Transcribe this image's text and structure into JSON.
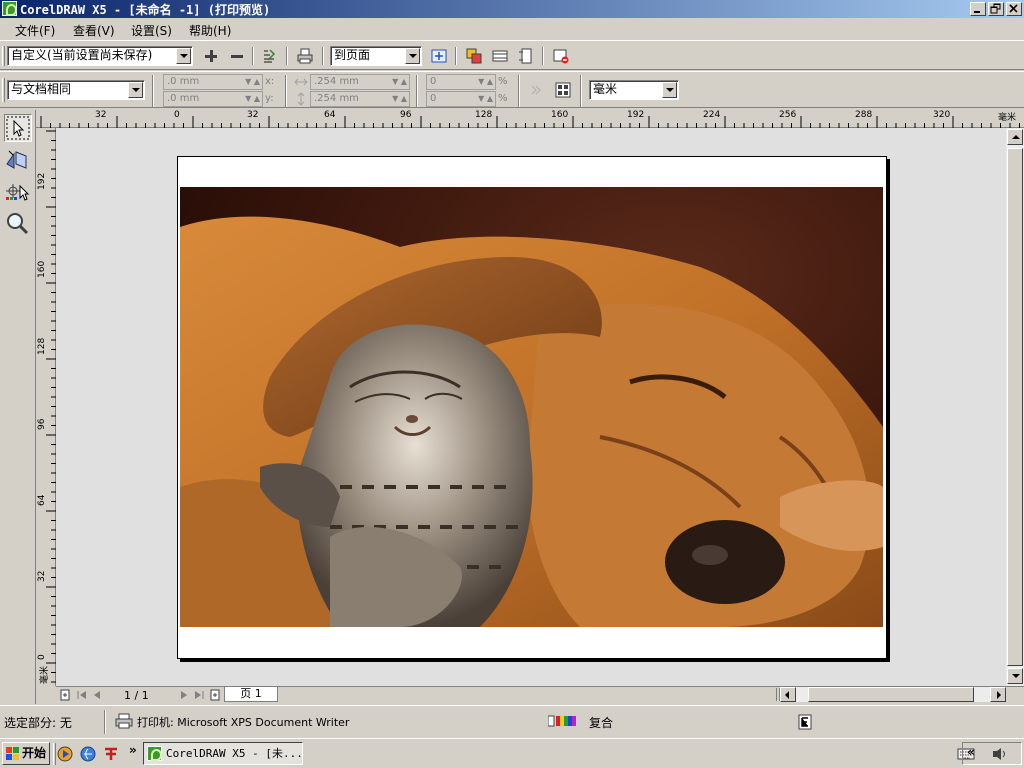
{
  "window": {
    "title": "CorelDRAW X5 - [未命名 -1] (打印预览)",
    "controls": {
      "minimize": "_",
      "maximize": "▫",
      "close": "×"
    }
  },
  "menu": {
    "items": [
      "文件(F)",
      "查看(V)",
      "设置(S)",
      "帮助(H)"
    ]
  },
  "toolbar1": {
    "preset_value": "自定义(当前设置尚未保存)",
    "fit_value": "到页面",
    "icons": [
      "add-icon",
      "remove-icon",
      "print-style-icon",
      "print-icon",
      "fit-page-icon",
      "page-preview-icon",
      "landscape-icon",
      "portrait-icon",
      "close-preview-icon"
    ]
  },
  "toolbar2": {
    "position_value": "与文档相同",
    "x_value": ".0 mm",
    "y_value": ".0 mm",
    "x_label": "x:",
    "y_label": "y:",
    "width_value": ".254 mm",
    "height_value": ".254 mm",
    "scale_x_value": "0",
    "scale_y_value": "0",
    "percent_label": "%",
    "units_value": "毫米"
  },
  "ruler": {
    "h_ticks": [
      "32",
      "0",
      "32",
      "64",
      "96",
      "128",
      "160",
      "192",
      "224",
      "256",
      "288",
      "320"
    ],
    "h_unit": "毫米",
    "v_ticks": [
      "192",
      "160",
      "128",
      "96",
      "64",
      "32",
      "0"
    ],
    "v_unit": "毫米"
  },
  "document": {
    "image_description": "sleeping dog and kitten"
  },
  "page_nav": {
    "counter": "1 / 1",
    "tab_label": "页 1"
  },
  "status": {
    "selection": "选定部分: 无",
    "printer": "打印机: Microsoft XPS Document Writer",
    "composite": "复合"
  },
  "taskbar": {
    "start_label": "开始",
    "task_label": "CorelDRAW X5 - [未...",
    "quicklaunch_more": "»",
    "tray_more": "«"
  }
}
